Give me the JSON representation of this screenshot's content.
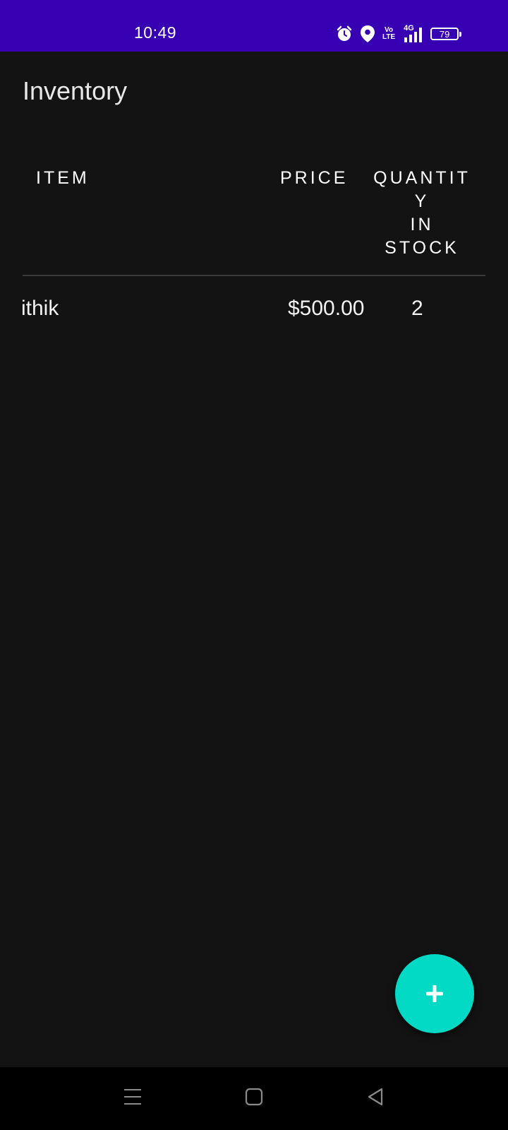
{
  "status_bar": {
    "time": "10:49",
    "volte_top": "Vo",
    "volte_bottom": "LTE",
    "network": "4G",
    "battery": "79",
    "color": "#3700b3"
  },
  "app": {
    "title": "Inventory"
  },
  "table": {
    "headers": {
      "item": "ITEM",
      "price": "PRICE",
      "quantity": "QUANTIT\nY\nIN\nSTOCK"
    },
    "rows": [
      {
        "name": "ithik",
        "price": "$500.00",
        "quantity": "2"
      }
    ]
  },
  "fab": {
    "icon": "plus-icon",
    "color": "#03dac5"
  },
  "nav_bar": {
    "icons": [
      "menu-icon",
      "home-icon",
      "back-icon"
    ]
  }
}
